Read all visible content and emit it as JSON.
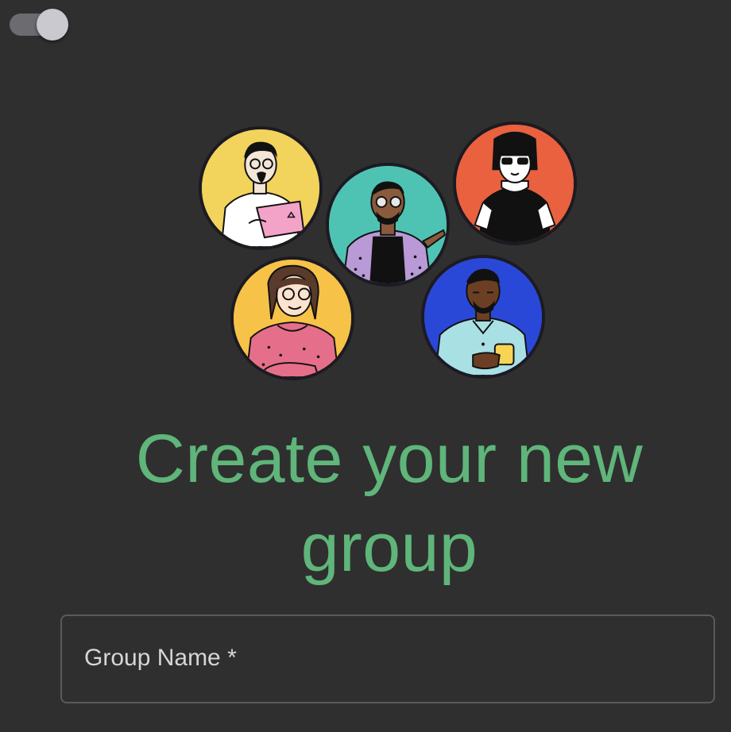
{
  "theme_toggle": {
    "icon": "toggle-switch-icon",
    "state": "on"
  },
  "avatars": [
    {
      "name": "avatar-man-laptop",
      "bg": "#f2d35b"
    },
    {
      "name": "avatar-man-pointing",
      "bg": "#4fc3b3"
    },
    {
      "name": "avatar-woman-sunglasses",
      "bg": "#e9613e"
    },
    {
      "name": "avatar-woman-sweater",
      "bg": "#f7c248"
    },
    {
      "name": "avatar-man-coffee",
      "bg": "#2a48d8"
    }
  ],
  "title": {
    "line1": "Create your new",
    "line2": "group"
  },
  "group_name_field": {
    "label": "Group Name *",
    "value": ""
  },
  "colors": {
    "background": "#2f2f2f",
    "title": "#5fb57a",
    "field_border": "#5a5a5a",
    "label": "#d6d6d6"
  }
}
